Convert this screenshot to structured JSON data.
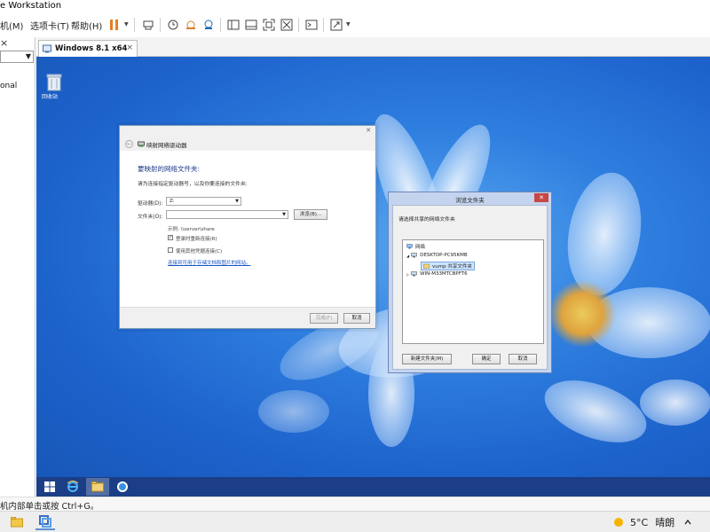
{
  "app": {
    "title": "e Workstation"
  },
  "menu": {
    "vm": "机(M)",
    "tabs": "选项卡(T)",
    "help": "帮助(H)"
  },
  "toolbar": {
    "icons": [
      "pause-icon",
      "send-ctrl-alt-del-icon",
      "snapshot-icon",
      "revert-snapshot-icon",
      "manage-snapshots-icon",
      "view-sidebar-icon",
      "view-thumbnails-icon",
      "fullscreen-icon",
      "unity-icon",
      "console-icon",
      "stretch-icon"
    ]
  },
  "left_panel": {
    "close": "×",
    "label": "onal"
  },
  "vm_tab": {
    "label": "Windows 8.1 x64",
    "close": "×"
  },
  "desktop": {
    "recycle_label": "回收站"
  },
  "map_drive": {
    "title": "映射网络驱动器",
    "heading": "要映射的网络文件夹:",
    "description": "请为连接指定驱动器号，以及你要连接的文件夹:",
    "drive_label": "驱动器(D):",
    "drive_value": "Z:",
    "folder_label": "文件夹(O):",
    "folder_value": "",
    "browse_button": "浏览(B)...",
    "example": "示例: \\\\server\\share",
    "reconnect_label": "登录时重新连接(R)",
    "reconnect_checked": true,
    "other_creds_label": "使用其他凭据连接(C)",
    "other_creds_checked": false,
    "link": "连接到可用于存储文档和图片的网站。",
    "finish_button": "完成(F)",
    "cancel_button": "取消"
  },
  "browse_folder": {
    "title": "浏览文件夹",
    "close": "✕",
    "prompt": "请选择共享的网络文件夹",
    "tree": [
      {
        "label": "网络",
        "level": 0,
        "expander": ""
      },
      {
        "label": "DESKTOP-PC95KMB",
        "level": 1,
        "expander": "◢"
      },
      {
        "label": "vump 共享文件夹",
        "level": 2,
        "expander": "",
        "selected": true
      },
      {
        "label": "WIN-M33MTCBPFT6",
        "level": 1,
        "expander": "▷"
      }
    ],
    "new_folder_button": "新建文件夹(M)",
    "ok_button": "确定",
    "cancel_button": "取消"
  },
  "guest_taskbar": {
    "icons": [
      "start-icon",
      "ie-icon",
      "explorer-icon",
      "network-icon"
    ]
  },
  "status": {
    "text": "机内部单击或按 Ctrl+G。"
  },
  "host_taskbar": {
    "icons": [
      "file-explorer-icon",
      "vmware-icon"
    ],
    "weather": {
      "temp": "5°C",
      "condition": "晴朗"
    }
  },
  "colors": {
    "desktop_blue": "#2f7fe0",
    "taskbar_blue": "#1b3e86",
    "pause_orange": "#e67e22",
    "link_blue": "#1a56c4"
  }
}
